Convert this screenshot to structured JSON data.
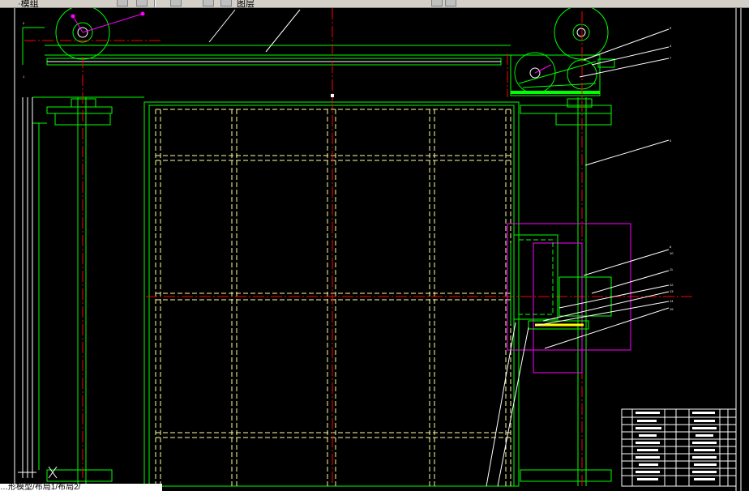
{
  "toolbar": {
    "layer_text": "·模组",
    "style_text": "图层",
    "right_icon": "icon-bulb"
  },
  "command_line": {
    "text": "…形模型/布局1/布局2/"
  },
  "drawing": {
    "colors": {
      "frame": "#00ff00",
      "centerline": "#ff0000",
      "hidden": "#ffffa0",
      "leader": "#ffffff",
      "magenta": "#ff00ff",
      "background": "#000000"
    }
  },
  "title_block": {
    "rows": 10
  }
}
